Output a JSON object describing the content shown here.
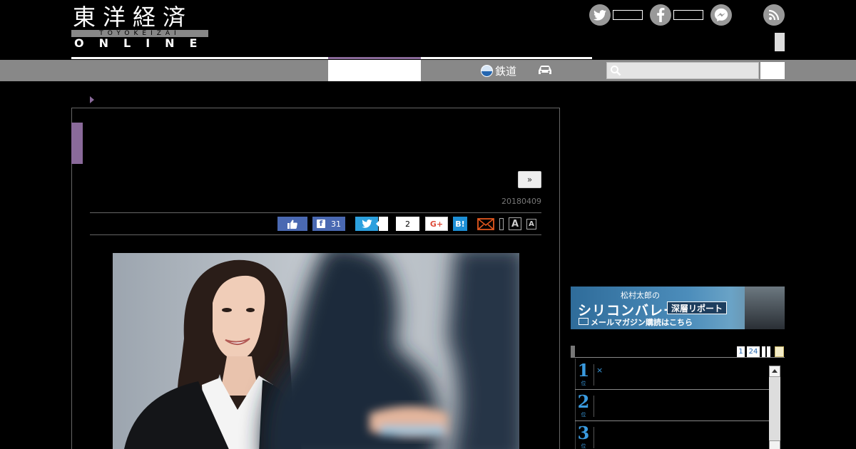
{
  "header": {
    "logo_jp": "東洋経済",
    "logo_sub": "TOYOKEIZAI",
    "logo_online": "ONLINE"
  },
  "nav": {
    "rail_label": "鉄道"
  },
  "search": {
    "placeholder": ""
  },
  "article": {
    "next_label": "»",
    "date": "20180409",
    "share": {
      "facebook_count": "31",
      "pocket_count": "2",
      "google_label": "G+",
      "hatena_label": "B!"
    },
    "font_large": "A",
    "font_small": "A"
  },
  "banner": {
    "top": "松村太郎の",
    "main": "シリコンバレー",
    "tag": "深層リポート",
    "bottom": "メールマガジン購読はこちら"
  },
  "ranking": {
    "tabs": [
      "1",
      "24"
    ],
    "rows": [
      {
        "rank": "1",
        "unit": "位",
        "text": "×"
      },
      {
        "rank": "2",
        "unit": "位",
        "text": ""
      },
      {
        "rank": "3",
        "unit": "位",
        "text": ""
      }
    ]
  },
  "colors": {
    "accent": "#8a6a9a",
    "facebook": "#4a69b2",
    "twitter": "#2ca0de",
    "hatena": "#1d8fd6",
    "rank": "#3a9be0"
  }
}
